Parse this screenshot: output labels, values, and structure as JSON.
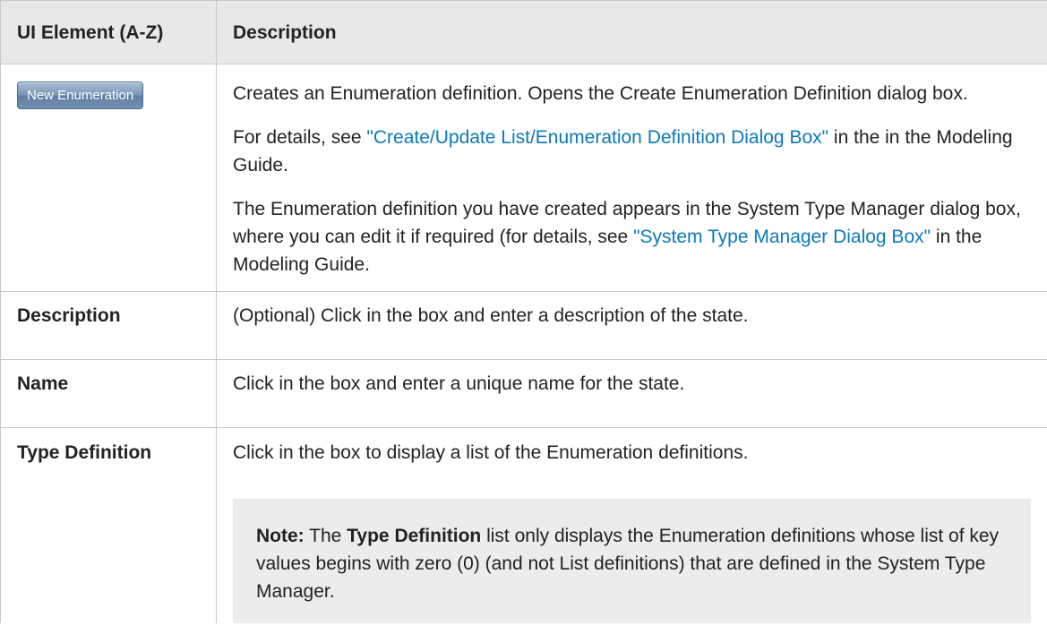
{
  "table": {
    "headers": {
      "element": "UI Element (A-Z)",
      "description": "Description"
    },
    "new_enumeration": {
      "button_label": "New Enumeration",
      "p1": "Creates an Enumeration definition. Opens the Create Enumeration Definition dialog box.",
      "p2_before": "For details, see ",
      "p2_link": "\"Create/Update List/Enumeration Definition Dialog Box\"",
      "p2_after": " in the in the Modeling Guide.",
      "p3_before": "The Enumeration definition you have created appears in the System Type Manager dialog box, where you can edit it if required (for details, see ",
      "p3_link": "\"System Type Manager Dialog Box\"",
      "p3_after": " in the Modeling Guide."
    },
    "rows": [
      {
        "element": "Description",
        "description": "(Optional) Click in the box and enter a description of the state."
      },
      {
        "element": "Name",
        "description": "Click in the box and enter a unique name for the state."
      }
    ],
    "type_definition": {
      "element": "Type Definition",
      "description": "Click in the box to display a list of the Enumeration definitions.",
      "note": {
        "label": "Note:",
        "text_before": " The ",
        "emphasis": "Type Definition",
        "text_after": " list only displays the Enumeration definitions whose list of key values begins with zero (0) (and not List definitions) that are defined in the System Type Manager."
      }
    }
  },
  "colors": {
    "header_bg": "#e8e8e8",
    "link": "#0a7ab8",
    "note_bg": "#ececec",
    "border": "#c8c8c8"
  }
}
